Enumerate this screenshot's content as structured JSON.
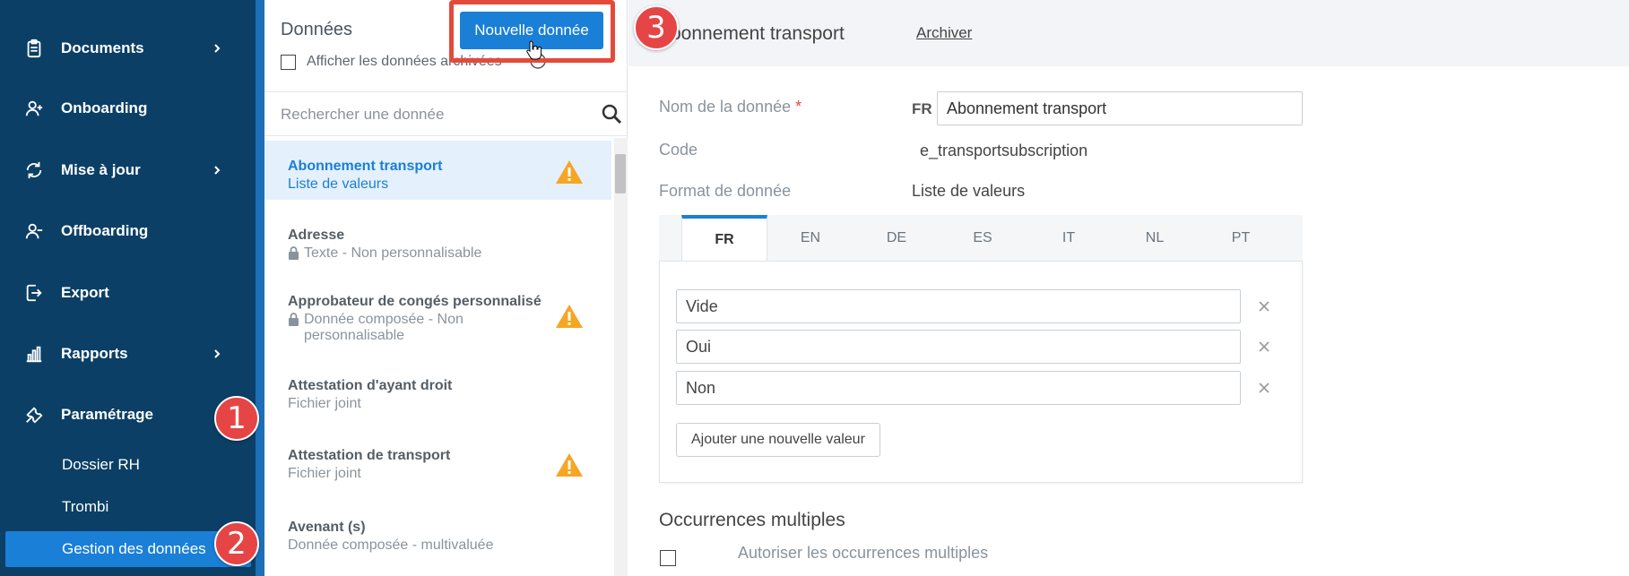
{
  "sidebar": {
    "items": [
      {
        "label": "Documents",
        "icon": "clipboard-icon",
        "has_chevron": true
      },
      {
        "label": "Onboarding",
        "icon": "user-plus-icon",
        "has_chevron": false
      },
      {
        "label": "Mise à jour",
        "icon": "refresh-icon",
        "has_chevron": true
      },
      {
        "label": "Offboarding",
        "icon": "user-minus-icon",
        "has_chevron": false
      },
      {
        "label": "Export",
        "icon": "export-icon",
        "has_chevron": false
      },
      {
        "label": "Rapports",
        "icon": "bar-chart-icon",
        "has_chevron": true
      },
      {
        "label": "Paramétrage",
        "icon": "tools-icon",
        "has_chevron": false
      }
    ],
    "subitems": [
      {
        "label": "Dossier RH",
        "active": false
      },
      {
        "label": "Trombi",
        "active": false
      },
      {
        "label": "Gestion des données",
        "active": true
      }
    ]
  },
  "callouts": [
    "1",
    "2",
    "3"
  ],
  "middle": {
    "title": "Données",
    "show_archived_label": "Afficher les données archivées",
    "new_button_label": "Nouvelle donnée",
    "search_placeholder": "Rechercher une donnée",
    "items": [
      {
        "title": "Abonnement transport",
        "subtitle": "Liste de valeurs",
        "locked": false,
        "warning": true,
        "selected": true
      },
      {
        "title": "Adresse",
        "subtitle": "Texte - Non personnalisable",
        "locked": true,
        "warning": false,
        "selected": false
      },
      {
        "title": "Approbateur de congés personnalisé",
        "subtitle": "Donnée composée - Non personnalisable",
        "locked": true,
        "warning": true,
        "selected": false
      },
      {
        "title": "Attestation d'ayant droit",
        "subtitle": "Fichier joint",
        "locked": false,
        "warning": false,
        "selected": false
      },
      {
        "title": "Attestation de transport",
        "subtitle": "Fichier joint",
        "locked": false,
        "warning": true,
        "selected": false
      },
      {
        "title": "Avenant (s)",
        "subtitle": "Donnée composée - multivaluée",
        "locked": false,
        "warning": false,
        "selected": false
      }
    ]
  },
  "detail": {
    "title": "Abonnement transport",
    "archive_label": "Archiver",
    "name_label": "Nom de la donnée",
    "required_mark": "*",
    "lang_prefix": "FR",
    "name_value": "Abonnement transport",
    "code_label": "Code",
    "code_value": "e_transportsubscription",
    "format_label": "Format de donnée",
    "format_value": "Liste de valeurs",
    "tabs": [
      "FR",
      "EN",
      "DE",
      "ES",
      "IT",
      "NL",
      "PT"
    ],
    "active_tab": "FR",
    "values": [
      "Vide",
      "Oui",
      "Non"
    ],
    "add_value_label": "Ajouter une nouvelle valeur",
    "occurrences_title": "Occurrences multiples",
    "occurrences_checkbox_label": "Autoriser les occurrences multiples"
  },
  "colors": {
    "sidebar_bg": "#0b3f66",
    "accent": "#1a7fd7",
    "callout": "#e64545",
    "warning": "#f5a623"
  }
}
